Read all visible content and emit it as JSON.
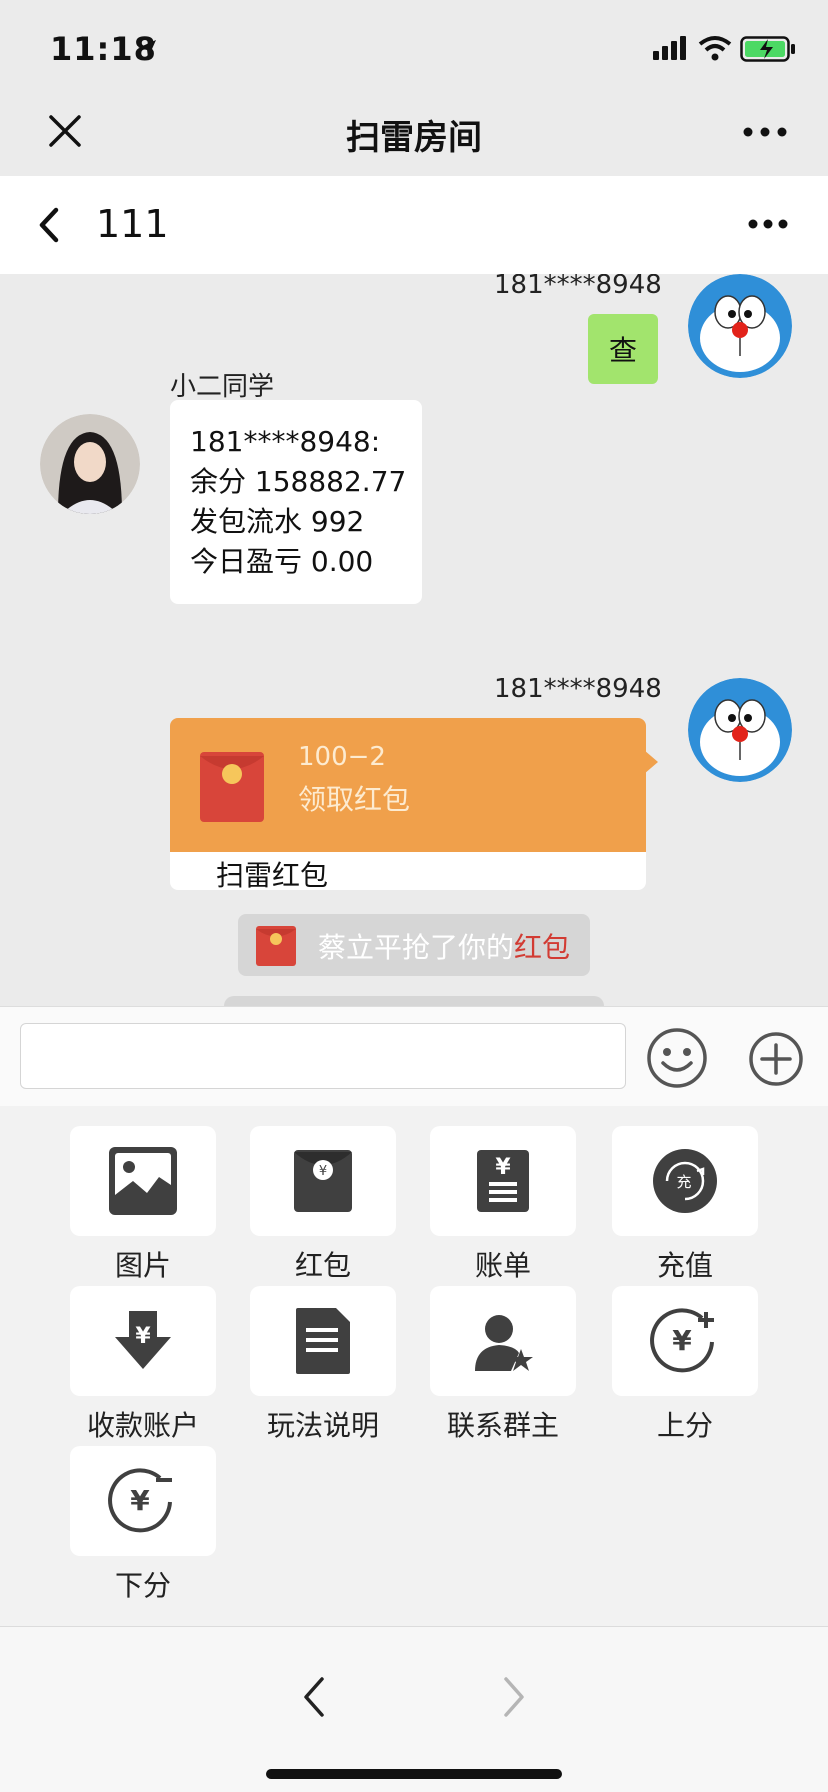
{
  "status_bar": {
    "time": "11:18",
    "icons": [
      "location-arrow-icon",
      "signal-icon",
      "wifi-icon",
      "battery-charging-icon"
    ],
    "battery_color": "#4cd964"
  },
  "top_nav": {
    "title": "扫雷房间",
    "close_icon": "close-icon",
    "more_icon": "more-icon"
  },
  "sub_header": {
    "title": "111",
    "back_icon": "back-arrow-icon",
    "more_icon": "more-icon"
  },
  "chat": {
    "messages": [
      {
        "side": "right",
        "sender": "181****8948",
        "type": "text",
        "text": "查"
      },
      {
        "side": "left",
        "sender": "小二同学",
        "type": "text",
        "lines": [
          "181****8948:",
          "余分 158882.77",
          "发包流水 992",
          "今日盈亏 0.00"
        ]
      },
      {
        "side": "right",
        "sender": "181****8948",
        "type": "red-packet",
        "amount": "100−2",
        "claim_text": "领取红包",
        "label": "扫雷红包"
      }
    ],
    "notice": {
      "prefix": "蔡立平抢了你的",
      "highlight": "红包"
    },
    "colors": {
      "self_bubble": "#a2e46d",
      "red_packet": "#f0a04b",
      "highlight": "#d23b33"
    }
  },
  "input_bar": {
    "value": "",
    "placeholder": ""
  },
  "tools": [
    {
      "label": "图片",
      "icon": "image-icon"
    },
    {
      "label": "红包",
      "icon": "red-packet-icon"
    },
    {
      "label": "账单",
      "icon": "bill-icon"
    },
    {
      "label": "充值",
      "icon": "recharge-icon",
      "icon_text": "充"
    },
    {
      "label": "收款账户",
      "icon": "receive-account-icon"
    },
    {
      "label": "玩法说明",
      "icon": "document-icon"
    },
    {
      "label": "联系群主",
      "icon": "contact-owner-icon"
    },
    {
      "label": "上分",
      "icon": "add-points-icon"
    },
    {
      "label": "下分",
      "icon": "remove-points-icon"
    }
  ],
  "bottom_nav": {
    "back_icon": "nav-back-icon",
    "forward_icon": "nav-forward-icon"
  }
}
